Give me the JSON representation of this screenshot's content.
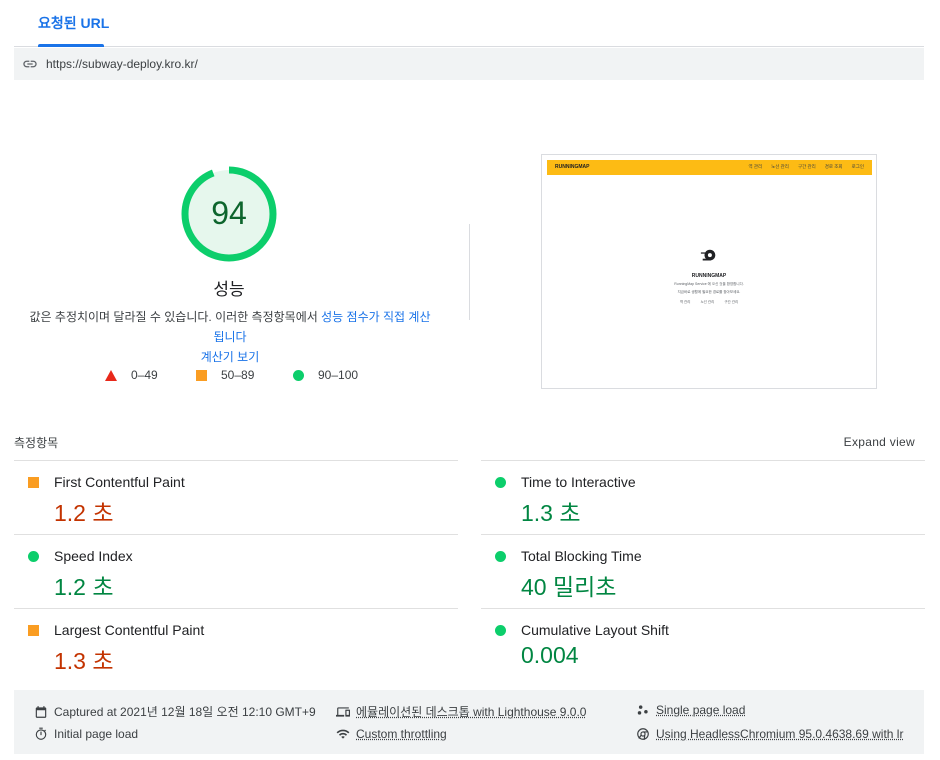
{
  "tabs": {
    "requested_url_label": "요청된 URL"
  },
  "url": {
    "value": "https://subway-deploy.kro.kr/"
  },
  "score": {
    "value": "94",
    "category": "성능",
    "description_text": "값은 추정치이며 달라질 수 있습니다. 이러한 측정항목에서 ",
    "description_link": "성능 점수가 직접 계산됩니다",
    "description_link2": "계산기 보기",
    "color": "#0cce6b"
  },
  "legend": [
    {
      "range": "0–49",
      "shape": "triangle",
      "color": "#e8281a"
    },
    {
      "range": "50–89",
      "shape": "square",
      "color": "#fa9d22"
    },
    {
      "range": "90–100",
      "shape": "circle",
      "color": "#0cce6b"
    }
  ],
  "screenshot": {
    "logo_text": "RUNNINGMAP",
    "nav": [
      "역 관리",
      "노선 관리",
      "구간 관리",
      "경로 조회",
      "로그인"
    ],
    "brand": "RUNNINGMAP",
    "line1": "RunningMap Service 에 오신 것을 환영합니다.",
    "line2": "지금바로 생활에 필요한 경로를 찾아보세요.",
    "links": [
      "역 관리",
      "노선 관리",
      "구간 관리"
    ]
  },
  "metrics": {
    "header": "측정항목",
    "expand": "Expand view",
    "left": [
      {
        "label": "First Contentful Paint",
        "value": "1.2 초",
        "status": "orange"
      },
      {
        "label": "Speed Index",
        "value": "1.2 초",
        "status": "green"
      },
      {
        "label": "Largest Contentful Paint",
        "value": "1.3 초",
        "status": "orange"
      }
    ],
    "right": [
      {
        "label": "Time to Interactive",
        "value": "1.3 초",
        "status": "green"
      },
      {
        "label": "Total Blocking Time",
        "value": "40 밀리초",
        "status": "green"
      },
      {
        "label": "Cumulative Layout Shift",
        "value": "0.004",
        "status": "green"
      }
    ]
  },
  "footer": {
    "captured": "Captured at 2021년 12월 18일 오전 12:10 GMT+9",
    "initial_load": "Initial page load",
    "emulated": "에뮬레이션된 데스크톱 with Lighthouse 9.0.0",
    "throttling": "Custom throttling",
    "single_page": "Single page load",
    "browser": "Using HeadlessChromium 95.0.4638.69 with lr"
  }
}
